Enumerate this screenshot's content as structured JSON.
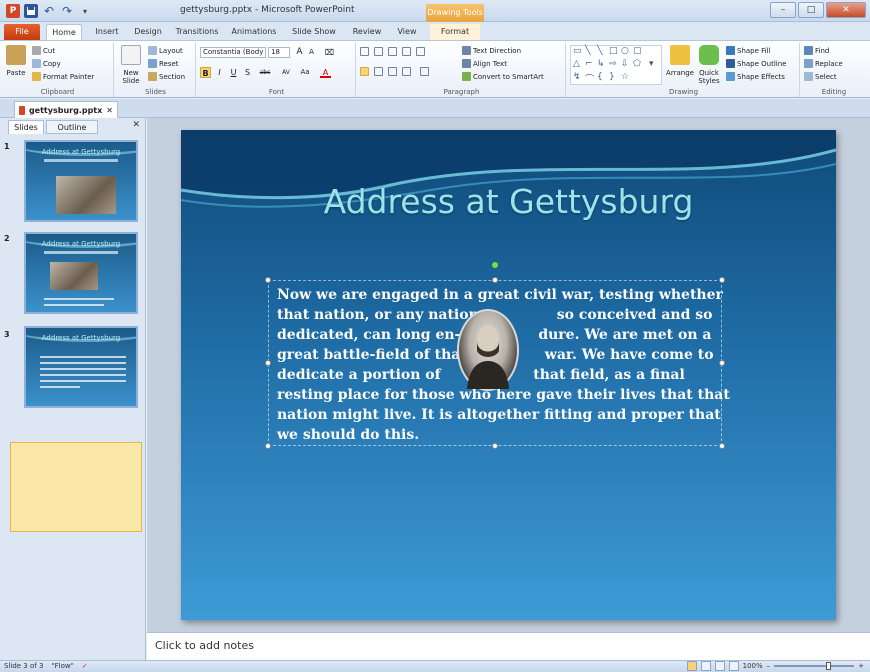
{
  "window": {
    "title": "gettysburg.pptx - Microsoft PowerPoint",
    "contextual_tab_group": "Drawing Tools",
    "min_label": "–",
    "max_label": "□",
    "close_label": "✕"
  },
  "qat": {
    "app_icon": "P",
    "undo": "↶",
    "redo": "↷",
    "customize": "▾"
  },
  "tabs": [
    "File",
    "Home",
    "Insert",
    "Design",
    "Transitions",
    "Animations",
    "Slide Show",
    "Review",
    "View",
    "Format"
  ],
  "ribbon": {
    "clipboard": {
      "paste": "Paste",
      "cut": "Cut",
      "copy": "Copy",
      "format_painter": "Format Painter",
      "label": "Clipboard"
    },
    "slides": {
      "new_slide": "New Slide",
      "layout": "Layout",
      "reset": "Reset",
      "section": "Section",
      "label": "Slides"
    },
    "font": {
      "face": "Constantia (Body",
      "size": "18",
      "grow": "A",
      "shrink": "A",
      "clear": "⌧",
      "bold": "B",
      "italic": "I",
      "underline": "U",
      "shadow": "S",
      "strike": "abc",
      "spacing": "AV",
      "case": "Aa",
      "color": "A",
      "label": "Font"
    },
    "paragraph": {
      "text_direction": "Text Direction",
      "align_text": "Align Text",
      "convert_smartart": "Convert to SmartArt",
      "label": "Paragraph"
    },
    "drawing": {
      "arrange": "Arrange",
      "quick_styles": "Quick Styles",
      "shape_fill": "Shape Fill",
      "shape_outline": "Shape Outline",
      "shape_effects": "Shape Effects",
      "label": "Drawing"
    },
    "editing": {
      "find": "Find",
      "replace": "Replace",
      "select": "Select",
      "label": "Editing"
    }
  },
  "document_tab": {
    "name": "gettysburg.pptx",
    "close": "✕"
  },
  "slides_panel": {
    "tabs": [
      "Slides",
      "Outline"
    ],
    "close": "✕",
    "thumbnails": [
      {
        "number": "1",
        "title": "Address at Gettysburg"
      },
      {
        "number": "2",
        "title": "Address at Gettysburg"
      },
      {
        "number": "3",
        "title": "Address at Gettysburg"
      }
    ]
  },
  "slide": {
    "title": "Address at Gettysburg",
    "body": [
      "Now we are engaged in a great civil war, testing whether",
      "that nation, or any nation                so conceived and so",
      "dedicated, can long en-                dure. We are met on a",
      "great battle-field of that                war. We have come to",
      "dedicate a portion of                   that field, as a final",
      "resting place for those who here gave their lives that that",
      "nation might live. It is altogether fitting and proper that",
      "we should do this."
    ]
  },
  "notes": {
    "placeholder": "Click to add notes"
  },
  "status": {
    "slide_info": "Slide 3 of 3",
    "theme": "\"Flow\"",
    "zoom": "100%",
    "zoom_out": "–",
    "zoom_in": "+"
  },
  "colors": {
    "accent": "#d24726",
    "title_color": "#9ce3ea",
    "slide_dark": "#0f4a78",
    "slide_light": "#3e9bd6"
  }
}
